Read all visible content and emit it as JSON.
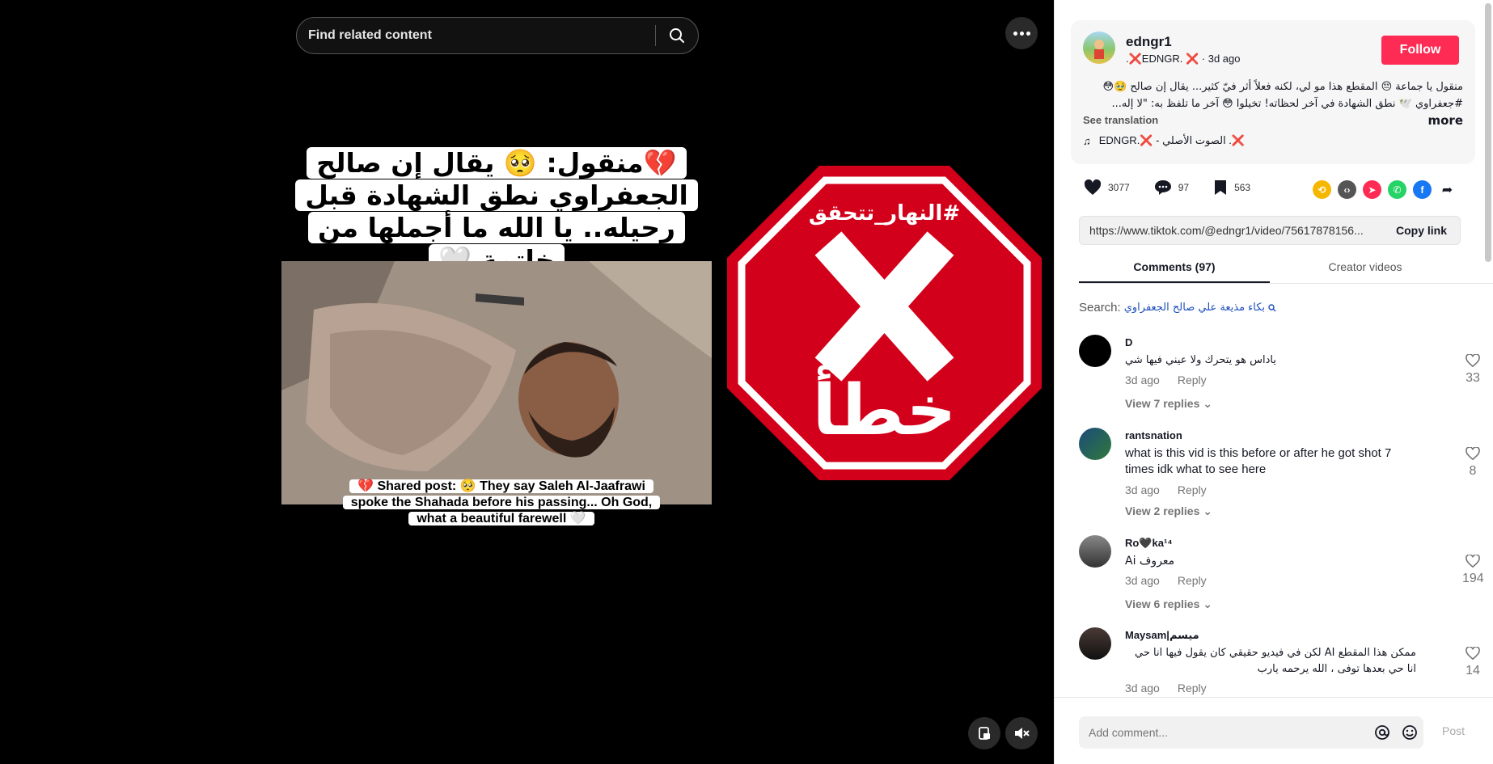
{
  "search": {
    "placeholder": "Find related content"
  },
  "video": {
    "caption_ar": "💔منقول: 🥺 يقال إن صالح الجعفراوي نطق الشهادة قبل رحيله.. يا الله ما أجملها من خاتمة 🤍",
    "caption_en": "💔 Shared post: 🥺 They say Saleh Al-Jaafrawi spoke the Shahada before his passing... Oh God, what a beautiful farewell 🤍",
    "stamp_hashtag": "#النهار_تتحقق",
    "stamp_word": "خطأ",
    "stamp_color": "#d2001a"
  },
  "post": {
    "username": "edngr1",
    "nickname": ".❌EDNGR. ❌",
    "time": "· 3d ago",
    "follow_label": "Follow",
    "description": "منقول يا جماعة 😔 المقطع هذا مو لي، لكنه فعلاً أثر فيّ كثير... يقال إن صالح 🥹😳 #جعفراوي 🕊️ نطق الشهادة في آخر لحظاته! تخيلوا 😳 آخر ما تلفظ به: \"لا إله...",
    "more_label": "more",
    "see_translation": "See translation",
    "music": "EDNGR.❌ - الصوت الأصلي .❌"
  },
  "actions": {
    "likes": "3077",
    "comments": "97",
    "saves": "563"
  },
  "link": {
    "url": "https://www.tiktok.com/@edngr1/video/75617878156...",
    "copy_label": "Copy link"
  },
  "tabs": {
    "comments": "Comments (97)",
    "creator": "Creator videos"
  },
  "comment_search": {
    "label": "Search:",
    "query": "بكاء مذيعة علي صالح الجعفراوي"
  },
  "comments": [
    {
      "user": "D",
      "text": "ياداس هو يتحرك ولا عيني فيها شي",
      "time": "3d ago",
      "reply": "Reply",
      "likes": "33",
      "replies": "View 7 replies"
    },
    {
      "user": "rantsnation",
      "text": "what is this vid is this before or after he got shot 7 times idk what to see here",
      "time": "3d ago",
      "reply": "Reply",
      "likes": "8",
      "replies": "View 2 replies"
    },
    {
      "user": "Ro🖤ka¹⁴",
      "text": "معروف Ai",
      "time": "3d ago",
      "reply": "Reply",
      "likes": "194",
      "replies": "View 6 replies"
    },
    {
      "user": "Maysam|ميسم",
      "text": "ممكن هذا المقطع AI لكن في فيديو حقيقي كان يقول فيها انا حي انا حي بعدها توفى ، الله يرحمه يارب",
      "time": "3d ago",
      "reply": "Reply",
      "likes": "14"
    }
  ],
  "add_comment": {
    "placeholder": "Add comment...",
    "post_label": "Post"
  }
}
